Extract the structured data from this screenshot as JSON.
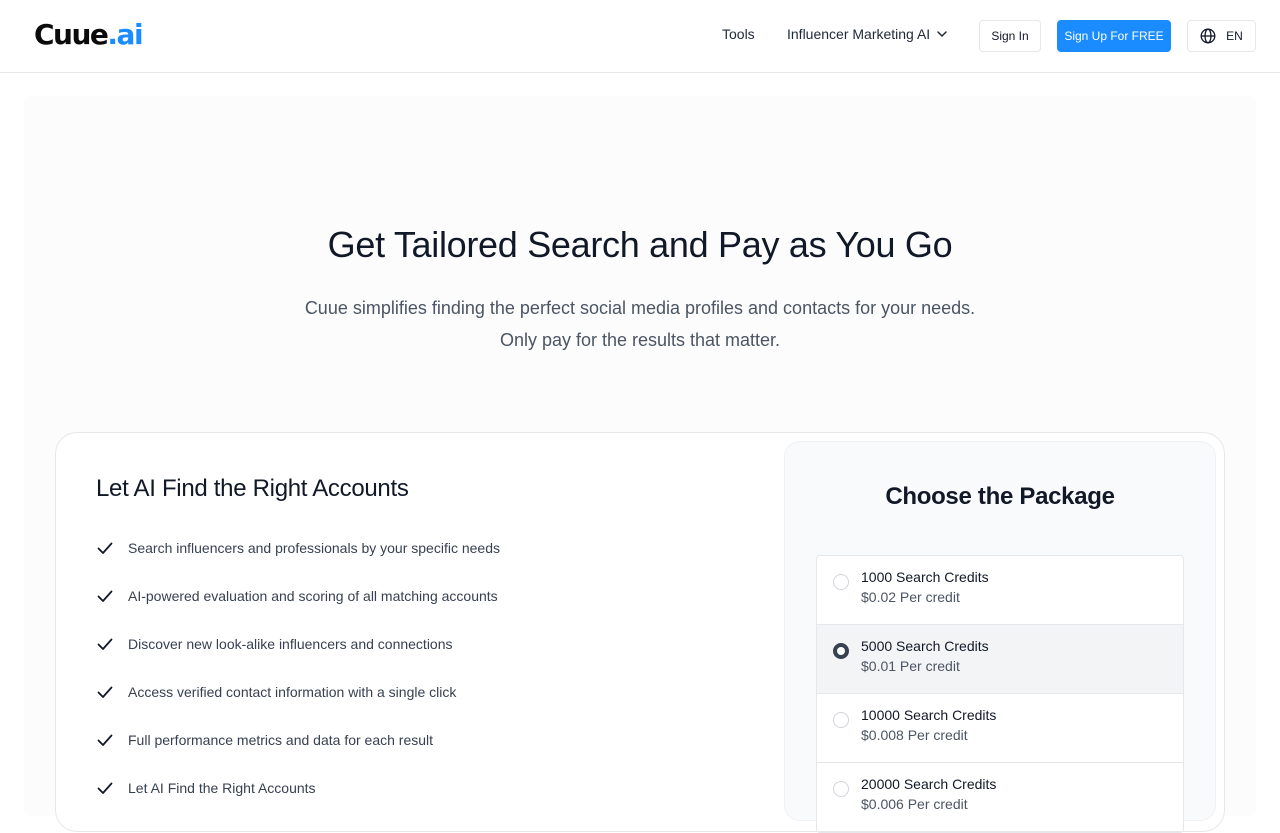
{
  "header": {
    "logo_main": "Cuue",
    "logo_accent": ".ai",
    "nav_tools": "Tools",
    "nav_influencer": "Influencer Marketing AI",
    "sign_in": "Sign In",
    "sign_up": "Sign Up For FREE",
    "language": "EN"
  },
  "hero": {
    "title": "Get Tailored Search and Pay as You Go",
    "subtitle_line1": "Cuue simplifies finding the perfect social media profiles and contacts for your needs.",
    "subtitle_line2": "Only pay for the results that matter."
  },
  "features": {
    "title": "Let AI Find the Right Accounts",
    "items": [
      "Search influencers and professionals by your specific needs",
      "AI-powered evaluation and scoring of all matching accounts",
      "Discover new look-alike influencers and connections",
      "Access verified contact information with a single click",
      "Full performance metrics and data for each result",
      "Let AI Find the Right Accounts"
    ]
  },
  "packages": {
    "title": "Choose the Package",
    "selected_index": 1,
    "items": [
      {
        "name": "1000 Search Credits",
        "price": "$0.02 Per credit"
      },
      {
        "name": "5000 Search Credits",
        "price": "$0.01 Per credit"
      },
      {
        "name": "10000 Search Credits",
        "price": "$0.008 Per credit"
      },
      {
        "name": "20000 Search Credits",
        "price": "$0.006 Per credit"
      }
    ]
  },
  "colors": {
    "accent": "#1a8cff",
    "text_primary": "#111827",
    "text_secondary": "#4b5563"
  }
}
